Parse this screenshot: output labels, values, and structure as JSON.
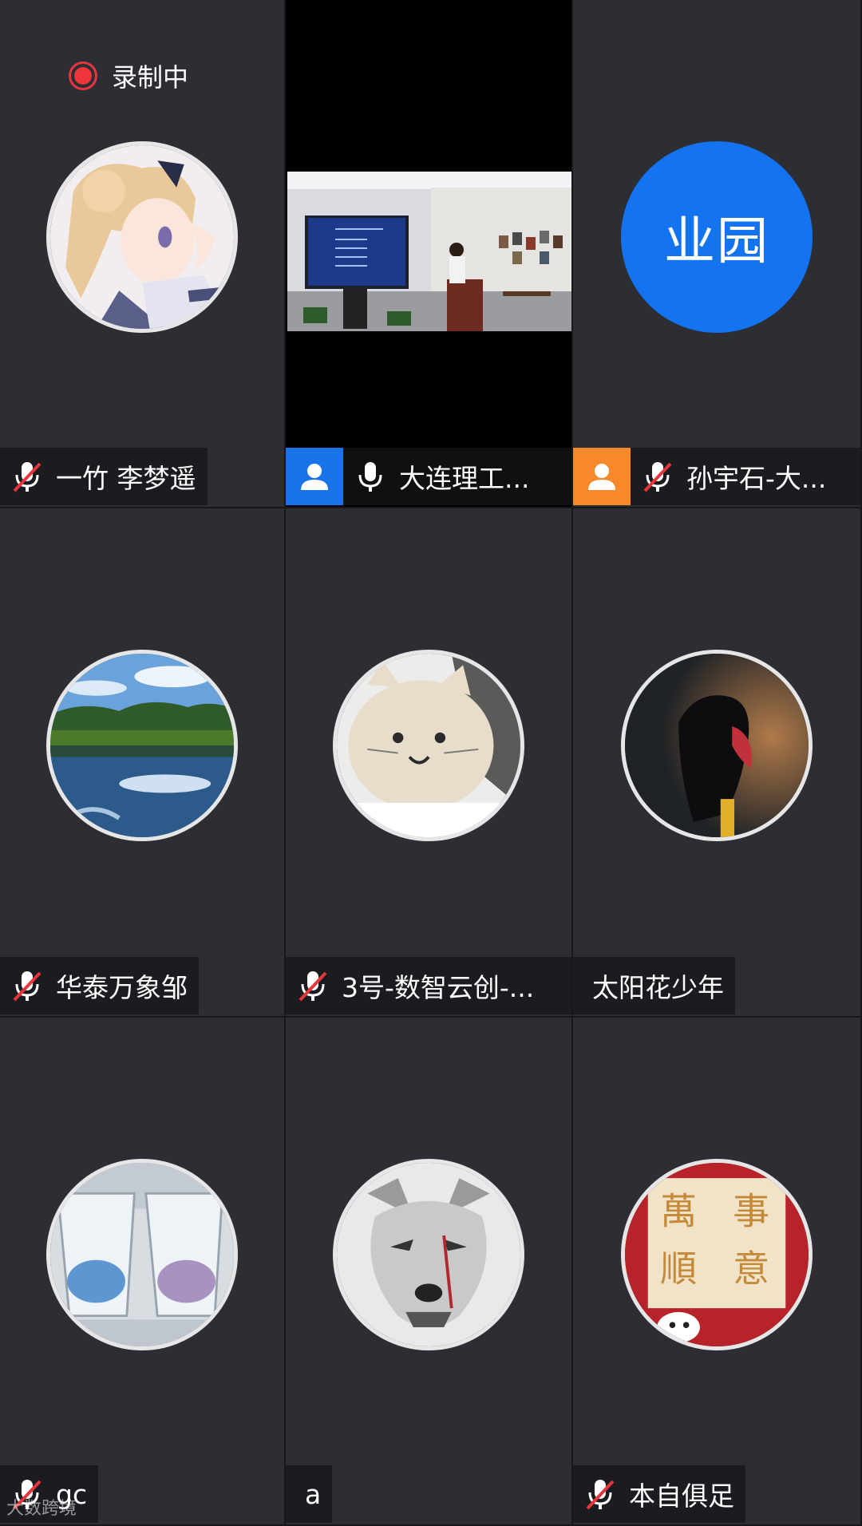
{
  "recording": {
    "label": "录制中",
    "color": "#f0353a"
  },
  "tiles": [
    {
      "name": "一竹 李梦遥",
      "mic": "muted",
      "avatar": "anime-girl-avatar"
    },
    {
      "name": "大连理工...",
      "mic": "on",
      "badge": "blue",
      "video": "presentation-room"
    },
    {
      "name": "孙宇石-大...",
      "mic": "muted",
      "badge": "orange",
      "initials": "业园",
      "initials_color": "#1373f0"
    },
    {
      "name": "华泰万象邹",
      "mic": "muted",
      "avatar": "lake-landscape-avatar"
    },
    {
      "name": "3号-数智云创-...",
      "mic": "muted",
      "avatar": "cat-meme-avatar"
    },
    {
      "name": "太阳花少年",
      "mic": "none",
      "avatar": "hooded-figure-avatar"
    },
    {
      "name": "gc",
      "mic": "muted",
      "avatar": "glasses-water-avatar"
    },
    {
      "name": "a",
      "mic": "none",
      "avatar": "wolf-sketch-avatar"
    },
    {
      "name": "本自俱足",
      "mic": "muted",
      "avatar": "wanshi-shunyi-avatar",
      "avatar_text": [
        "萬",
        "事",
        "順",
        "意"
      ]
    }
  ],
  "watermark": "大数跨境"
}
